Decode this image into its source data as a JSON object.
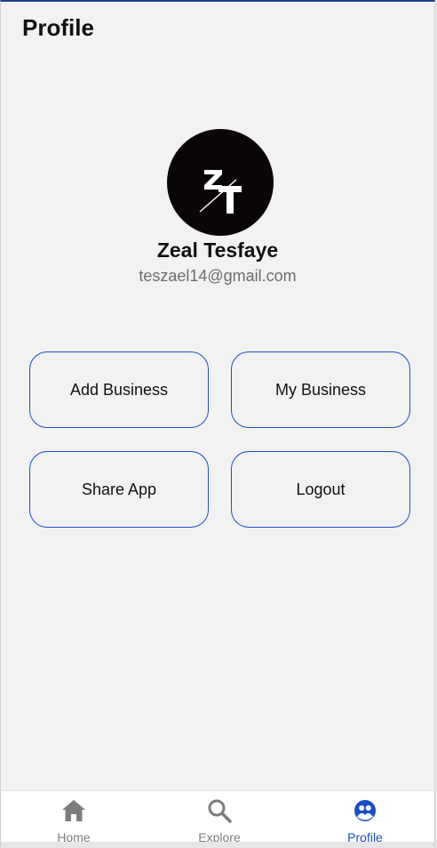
{
  "header": {
    "title": "Profile"
  },
  "profile": {
    "avatar_initials": "ZT",
    "name": "Zeal Tesfaye",
    "email": "teszael14@gmail.com"
  },
  "actions": {
    "add_business": "Add Business",
    "my_business": "My Business",
    "share_app": "Share App",
    "logout": "Logout"
  },
  "bottom_nav": {
    "items": [
      {
        "label": "Home",
        "icon": "home-icon",
        "active": false
      },
      {
        "label": "Explore",
        "icon": "search-icon",
        "active": false
      },
      {
        "label": "Profile",
        "icon": "profile-icon",
        "active": true
      }
    ]
  },
  "colors": {
    "accent": "#1a4fc4",
    "background": "#f2f2f2",
    "avatar_bg": "#0a0606",
    "inactive_nav": "#7d7d7d"
  }
}
